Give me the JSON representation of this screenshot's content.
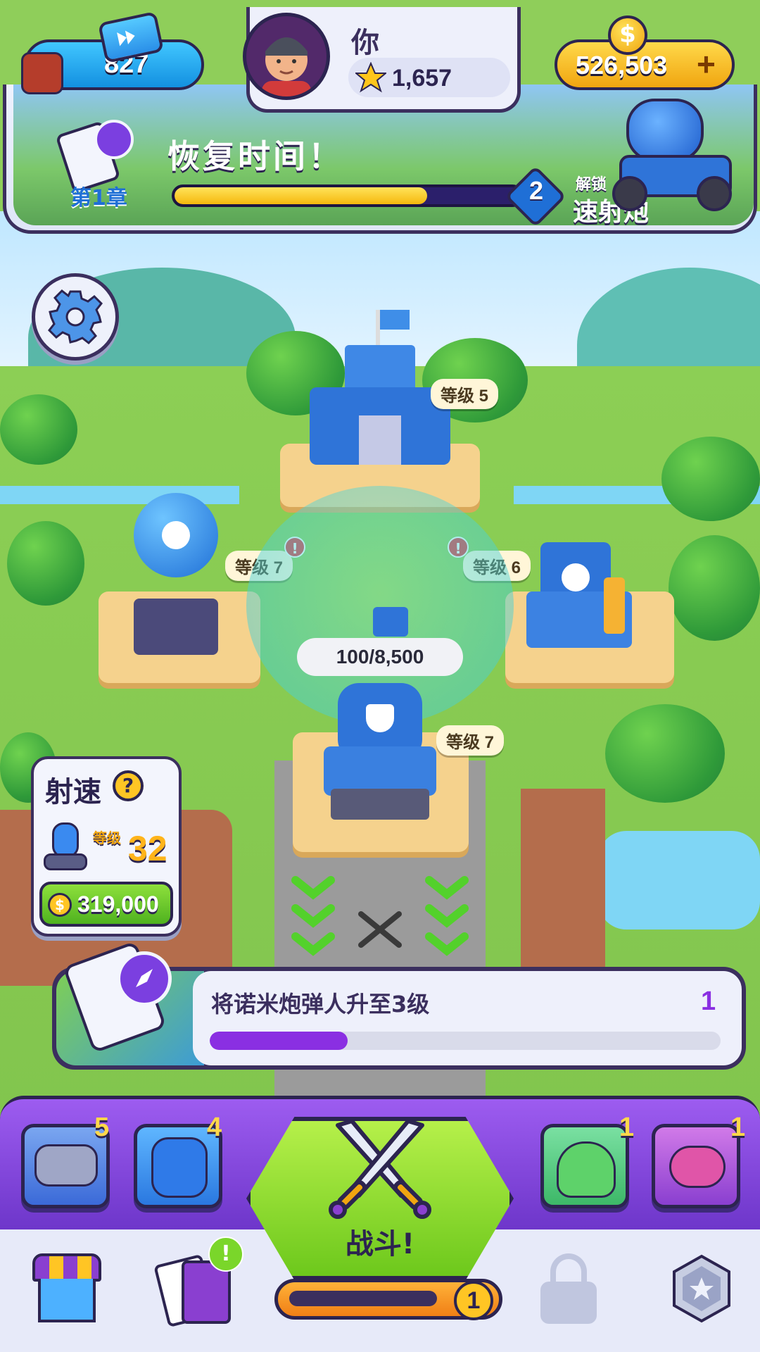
{
  "hud": {
    "tickets": "827",
    "player_name": "你",
    "stars": "1,657",
    "coins": "526,503",
    "add_symbol": "+",
    "chapter_label": "第1章",
    "chapter_title": "恢复时间！",
    "chapter_progress": 0.73,
    "unlock_level": "2",
    "unlock_label": "解锁",
    "unlock_item": "速射炮"
  },
  "buildings": [
    {
      "label": "等级 5"
    },
    {
      "label": "等级 7",
      "alert": "!"
    },
    {
      "label": "等级 6",
      "alert": "!"
    },
    {
      "label": "等级 7"
    }
  ],
  "shield_progress": "100/8,500",
  "fire_rate": {
    "title": "射速",
    "help": "?",
    "level_label": "等级",
    "level": "32",
    "cost": "319,000"
  },
  "quest": {
    "text": "将诺米炮弹人升至3级",
    "count": "1",
    "progress": 0.27
  },
  "cards": [
    {
      "name": "triple-cannon-card",
      "count": "5"
    },
    {
      "name": "blue-cat-card",
      "count": "4"
    },
    {
      "name": "green-slime-card",
      "count": "1"
    },
    {
      "name": "purple-bot-card",
      "count": "1"
    }
  ],
  "battle": {
    "label": "战斗!",
    "trophy_level": "1"
  },
  "nav": {
    "cards_alert": "!"
  },
  "colors": {
    "accent_purple": "#7b3fe0",
    "battle_green": "#7fd62a",
    "coin_gold": "#ffc524",
    "ticket_blue": "#1fa7ea"
  }
}
